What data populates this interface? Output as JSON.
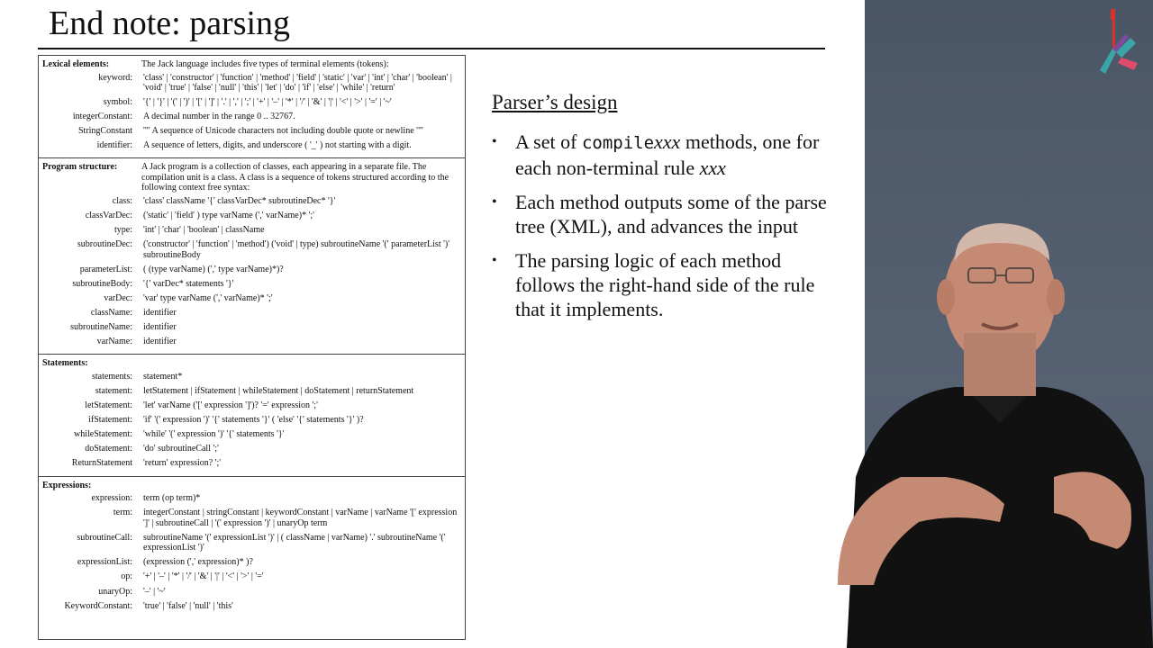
{
  "slide": {
    "title": "End note: parsing",
    "design_title": "Parser’s design",
    "bullets": [
      {
        "pre": "A set of ",
        "code": "compile",
        "ital": "xxx",
        "post": " methods, one for each non-terminal rule ",
        "tail_ital": "xxx"
      },
      {
        "text": "Each method outputs some of the parse tree (XML), and advances the input"
      },
      {
        "text": "The parsing logic of each method follows the right-hand side of the rule that it implements."
      }
    ]
  },
  "grammar": {
    "lexical": {
      "title": "Lexical elements:",
      "desc": "The Jack language includes five types of terminal elements (tokens):",
      "rules": [
        {
          "name": "keyword:",
          "def": "'class' | 'constructor' | 'function' | 'method' | 'field' | 'static' | 'var' | 'int' | 'char' | 'boolean' | 'void' | 'true' | 'false' | 'null' | 'this' | 'let' | 'do' | 'if' | 'else' | 'while' | 'return'"
        },
        {
          "name": "symbol:",
          "def": "'{' | '}' | '(' | ')' | '[' | ']' | '.' | ',' | ';' | '+' | '–' | '*' | '/' | '&' | '|' | '<' | '>' | '=' | '~'"
        },
        {
          "name": "integerConstant:",
          "def": "A decimal number in the range 0 .. 32767."
        },
        {
          "name": "StringConstant",
          "def": "'\"' A sequence of Unicode characters not including double quote or newline '\"'"
        },
        {
          "name": "identifier:",
          "def": "A sequence of letters, digits, and underscore ( '_' ) not starting with a digit."
        }
      ]
    },
    "program": {
      "title": "Program structure:",
      "desc": "A Jack program is a collection of classes, each appearing in a separate file. The compilation unit is a class. A class is a sequence of tokens structured according to the following context free syntax:",
      "rules": [
        {
          "name": "class:",
          "def": "'class' className '{' classVarDec* subroutineDec* '}'"
        },
        {
          "name": "classVarDec:",
          "def": "('static' | 'field' ) type varName (',' varName)* ';'"
        },
        {
          "name": "type:",
          "def": "'int' | 'char' | 'boolean' | className"
        },
        {
          "name": "subroutineDec:",
          "def": "('constructor' | 'function' | 'method') ('void' | type) subroutineName '(' parameterList ')' subroutineBody"
        },
        {
          "name": "parameterList:",
          "def": "( (type varName) (',' type varName)*)?"
        },
        {
          "name": "subroutineBody:",
          "def": "'{' varDec* statements '}'"
        },
        {
          "name": "varDec:",
          "def": "'var' type varName (',' varName)* ';'"
        },
        {
          "name": "className:",
          "def": "identifier"
        },
        {
          "name": "subroutineName:",
          "def": "identifier"
        },
        {
          "name": "varName:",
          "def": "identifier"
        }
      ]
    },
    "statements": {
      "title": "Statements:",
      "rules": [
        {
          "name": "statements:",
          "def": "statement*"
        },
        {
          "name": "statement:",
          "def": "letStatement | ifStatement | whileStatement | doStatement | returnStatement"
        },
        {
          "name": "letStatement:",
          "def": "'let' varName ('[' expression ']')? '=' expression ';'"
        },
        {
          "name": "ifStatement:",
          "def": "'if' '(' expression ')' '{' statements '}' ( 'else' '{' statements '}' )?"
        },
        {
          "name": "whileStatement:",
          "def": "'while' '(' expression ')' '{' statements '}'"
        },
        {
          "name": "doStatement:",
          "def": "'do' subroutineCall ';'"
        },
        {
          "name": "ReturnStatement",
          "def": "'return' expression? ';'"
        }
      ]
    },
    "expressions": {
      "title": "Expressions:",
      "rules": [
        {
          "name": "expression:",
          "def": "term (op term)*"
        },
        {
          "name": "term:",
          "def": "integerConstant | stringConstant | keywordConstant | varName | varName '[' expression ']' | subroutineCall | '(' expression ')' | unaryOp term"
        },
        {
          "name": "subroutineCall:",
          "def": "subroutineName '(' expressionList ')' | ( className | varName) '.' subroutineName '(' expressionList ')'"
        },
        {
          "name": "expressionList:",
          "def": "(expression (',' expression)* )?"
        },
        {
          "name": "op:",
          "def": "'+' | '–' | '*' | '/' | '&' | '|' | '<' | '>' | '='"
        },
        {
          "name": "unaryOp:",
          "def": "'–' | '~'"
        },
        {
          "name": "KeywordConstant:",
          "def": "'true' | 'false' | 'null' | 'this'"
        }
      ]
    }
  },
  "colors": {
    "panel": "#4f5a6a",
    "shirt": "#111111",
    "skin": "#c48a74",
    "logo_red": "#d9332b",
    "logo_teal": "#3aa5a8"
  },
  "icons": {
    "logo": "course-logo-icon"
  }
}
